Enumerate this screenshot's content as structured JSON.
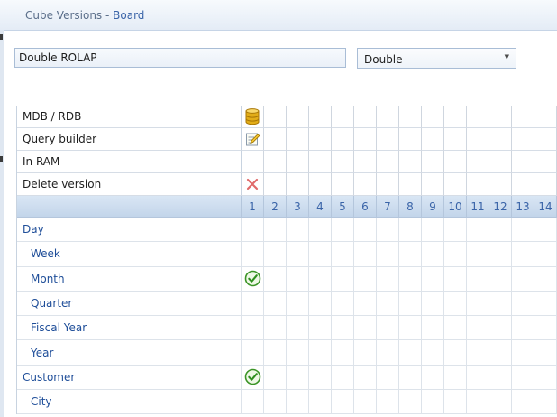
{
  "window": {
    "title": "Cube Versions",
    "app_name": "Board"
  },
  "version_name": {
    "value": "Double ROLAP"
  },
  "version_type": {
    "selected": "Double"
  },
  "grid": {
    "top_rows": [
      {
        "label": "MDB / RDB",
        "icon": "database-icon"
      },
      {
        "label": "Query builder",
        "icon": "query-builder-icon"
      },
      {
        "label": "In RAM",
        "icon": ""
      },
      {
        "label": "Delete version",
        "icon": "delete-icon"
      }
    ],
    "columns": [
      "1",
      "2",
      "3",
      "4",
      "5",
      "6",
      "7",
      "8",
      "9",
      "10",
      "11",
      "12",
      "13",
      "14"
    ],
    "dimensions": [
      {
        "label": "Day",
        "indent": false,
        "checked_column": null
      },
      {
        "label": "Week",
        "indent": true,
        "checked_column": null
      },
      {
        "label": "Month",
        "indent": true,
        "checked_column": "1"
      },
      {
        "label": "Quarter",
        "indent": true,
        "checked_column": null
      },
      {
        "label": "Fiscal Year",
        "indent": true,
        "checked_column": null
      },
      {
        "label": "Year",
        "indent": true,
        "checked_column": null
      },
      {
        "label": "Customer",
        "indent": false,
        "checked_column": "1"
      },
      {
        "label": "City",
        "indent": true,
        "checked_column": null
      }
    ]
  },
  "colors": {
    "accent": "#3a64a8",
    "dimension_text": "#1f4e99",
    "check": "#2f8f1f",
    "delete": "#e06a6a"
  }
}
